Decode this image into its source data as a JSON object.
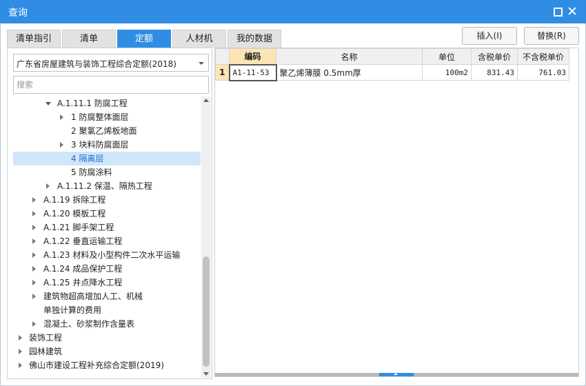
{
  "window": {
    "title": "查询"
  },
  "tabs": [
    "清单指引",
    "清单",
    "定额",
    "人材机",
    "我的数据"
  ],
  "buttons": {
    "insert": "插入(I)",
    "replace": "替换(R)"
  },
  "left": {
    "select_value": "广东省房屋建筑与装饰工程综合定额(2018)",
    "search_placeholder": "搜索",
    "tree": [
      {
        "label": "A.1.11.1 防腐工程",
        "toggle": "down"
      },
      {
        "label": "1 防腐整体面层",
        "toggle": "right"
      },
      {
        "label": "2 聚氯乙烯板地面",
        "toggle": ""
      },
      {
        "label": "3 块料防腐面层",
        "toggle": "right"
      },
      {
        "label": "4 隔离层",
        "toggle": ""
      },
      {
        "label": "5 防腐涂料",
        "toggle": ""
      },
      {
        "label": "A.1.11.2 保温、隔热工程",
        "toggle": "right"
      },
      {
        "label": "A.1.19 拆除工程",
        "toggle": "right"
      },
      {
        "label": "A.1.20 模板工程",
        "toggle": "right"
      },
      {
        "label": "A.1.21 脚手架工程",
        "toggle": "right"
      },
      {
        "label": "A.1.22 垂直运输工程",
        "toggle": "right"
      },
      {
        "label": "A.1.23 材料及小型构件二次水平运输",
        "toggle": "right"
      },
      {
        "label": "A.1.24 成品保护工程",
        "toggle": "right"
      },
      {
        "label": "A.1.25 井点降水工程",
        "toggle": "right"
      },
      {
        "label": "建筑物超高增加人工、机械",
        "toggle": "right"
      },
      {
        "label": "单独计算的费用",
        "toggle": ""
      },
      {
        "label": "混凝土、砂浆制作含量表",
        "toggle": "right"
      },
      {
        "label": "装饰工程",
        "toggle": "right"
      },
      {
        "label": "园林建筑",
        "toggle": "right"
      },
      {
        "label": "佛山市建设工程补充综合定额(2019)",
        "toggle": "right"
      }
    ]
  },
  "grid": {
    "headers": [
      "",
      "编码",
      "名称",
      "单位",
      "含税单价",
      "不含税单价"
    ],
    "rows": [
      {
        "num": "1",
        "code": "A1-11-53",
        "name": "聚乙烯薄膜 0.5mm厚",
        "unit": "100m2",
        "tax_price": "831.43",
        "notax_price": "761.03"
      }
    ]
  },
  "colors": {
    "accent": "#2f8de4",
    "selected_row": "#cfe6fb",
    "header_highlight": "#fce4b4"
  }
}
